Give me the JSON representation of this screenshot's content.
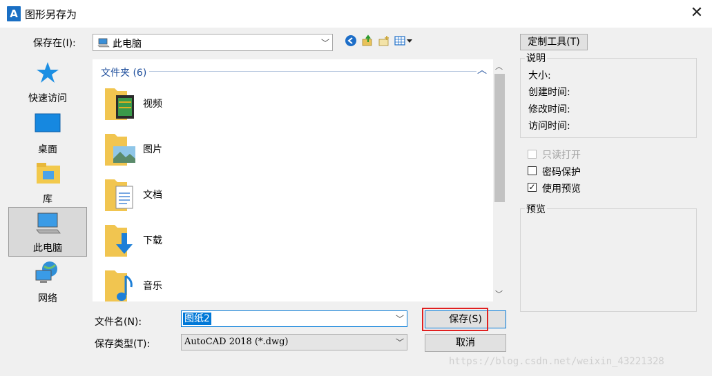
{
  "window": {
    "title": "图形另存为",
    "close_glyph": "✕",
    "app_icon_letter": "A"
  },
  "save_in": {
    "label": "保存在(I):",
    "location": "此电脑"
  },
  "toolbar": {
    "back_icon": "back-arrow-icon",
    "up_icon": "up-folder-icon",
    "new_folder_icon": "new-folder-icon",
    "views_icon": "views-menu-icon"
  },
  "sidebar": {
    "items": [
      {
        "label": "快速访问",
        "icon": "star-icon"
      },
      {
        "label": "桌面",
        "icon": "desktop-icon"
      },
      {
        "label": "库",
        "icon": "library-icon"
      },
      {
        "label": "此电脑",
        "icon": "computer-icon",
        "selected": true
      },
      {
        "label": "网络",
        "icon": "network-icon"
      }
    ]
  },
  "file_list": {
    "group_header": "文件夹 (6)",
    "items": [
      {
        "name": "视频",
        "icon": "video-folder-icon"
      },
      {
        "name": "图片",
        "icon": "pictures-folder-icon"
      },
      {
        "name": "文档",
        "icon": "documents-folder-icon"
      },
      {
        "name": "下载",
        "icon": "downloads-folder-icon"
      },
      {
        "name": "音乐",
        "icon": "music-folder-icon"
      }
    ]
  },
  "filename": {
    "label": "文件名(N):",
    "value": "图纸2"
  },
  "filetype": {
    "label": "保存类型(T):",
    "value": "AutoCAD 2018 (*.dwg)"
  },
  "buttons": {
    "save": "保存(S)",
    "cancel": "取消",
    "custom_tools": "定制工具(T)"
  },
  "description": {
    "title": "说明",
    "size_label": "大小:",
    "created_label": "创建时间:",
    "modified_label": "修改时间:",
    "accessed_label": "访问时间:"
  },
  "options": {
    "readonly": {
      "label": "只读打开",
      "checked": false,
      "enabled": false
    },
    "password": {
      "label": "密码保护",
      "checked": false
    },
    "use_preview": {
      "label": "使用预览",
      "checked": true
    }
  },
  "preview": {
    "title": "预览"
  },
  "watermark": "https://blog.csdn.net/weixin_43221328",
  "colors": {
    "accent": "#0078d7",
    "highlight": "#e02020",
    "group_header": "#1e4e9c"
  }
}
